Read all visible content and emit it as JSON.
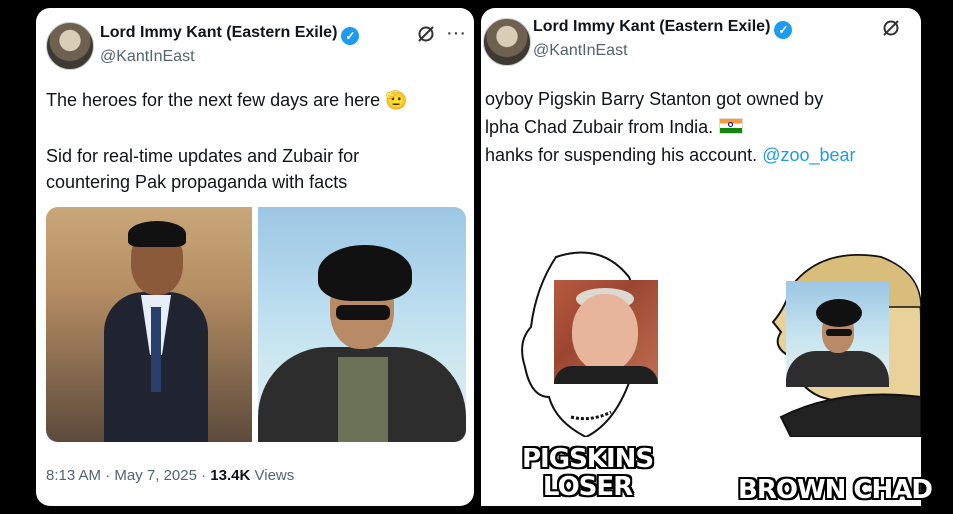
{
  "left_tweet": {
    "author_name": "Lord Immy Kant (Eastern Exile)",
    "handle": "@KantInEast",
    "text_line1": "The heroes for the next few days are here",
    "text_emoji": "🫡",
    "text_line2": "Sid for real-time updates and Zubair for",
    "text_line3": "countering Pak propaganda with facts",
    "time": "8:13 AM",
    "separator": "·",
    "date": "May 7, 2025",
    "views_count": "13.4K",
    "views_label": "Views"
  },
  "right_tweet": {
    "author_name": "Lord Immy Kant (Eastern Exile)",
    "handle": "@KantInEast",
    "text_line1": "oyboy Pigskin Barry Stanton got owned by",
    "text_line2": "lpha Chad Zubair from India.",
    "text_line3": "hanks for suspending his account.",
    "mention": "@zoo_bear",
    "meme_label_left_1": "PIGSKINS",
    "meme_label_left_2": "LOSER",
    "meme_label_right": "BROWN CHAD"
  },
  "icons": {
    "verified": "verified-badge-icon",
    "grok": "grok-icon",
    "more": "more-icon",
    "flag": "india-flag-icon"
  },
  "colors": {
    "link": "#1d9bf0",
    "text": "#0f1419",
    "secondary": "#536471",
    "background": "#000000"
  }
}
